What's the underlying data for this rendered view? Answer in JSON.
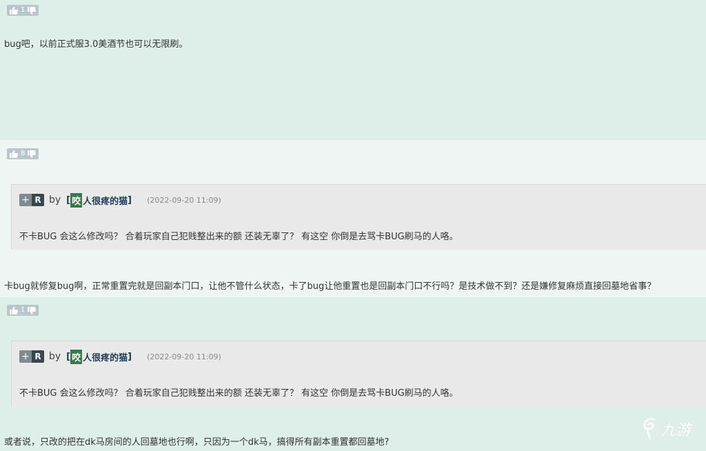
{
  "posts": [
    {
      "votes": "1",
      "text": "bug吧，以前正式服3.0美酒节也可以无限刷。"
    },
    {
      "votes": "8",
      "quote": {
        "prefix_plus": "+",
        "prefix_r": "R",
        "by": "by",
        "open_bracket": "[",
        "user_first": "咬",
        "user_rest": "人很疼的猫",
        "close_bracket": "]",
        "date": "(2022-09-20 11:09)",
        "text": "不卡BUG 会这么修改吗？  合着玩家自己犯贱整出来的额 还装无辜了？  有这空 你倒是去骂卡BUG刷马的人咯。"
      },
      "text": "卡bug就修复bug啊，正常重置完就是回副本门口，让他不管什么状态，卡了bug让他重置也是回副本门口不行吗？是技术做不到？还是嫌修复麻烦直接回墓地省事？"
    },
    {
      "votes": "1",
      "quote": {
        "prefix_plus": "+",
        "prefix_r": "R",
        "by": "by",
        "open_bracket": "[",
        "user_first": "咬",
        "user_rest": "人很疼的猫",
        "close_bracket": "]",
        "date": "(2022-09-20 11:09)",
        "text": "不卡BUG 会这么修改吗？  合着玩家自己犯贱整出来的额 还装无辜了？  有这空 你倒是去骂卡BUG刷马的人咯。"
      },
      "text": "或者说，只改的把在dk马房间的人回墓地也行啊，只因为一个dk马，搞得所有副本重置都回墓地?"
    }
  ],
  "watermark": "九游"
}
